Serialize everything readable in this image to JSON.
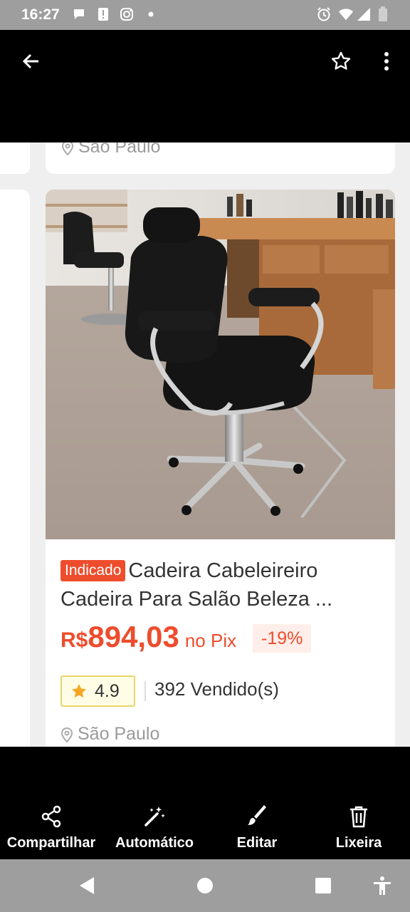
{
  "status_bar": {
    "time": "16:27",
    "icons": [
      "chat-bubble-icon",
      "alert-icon",
      "instagram-icon",
      "dot-icon",
      "alarm-icon",
      "wifi-icon",
      "signal-icon",
      "battery-icon"
    ]
  },
  "app_bar": {
    "back_icon": "arrow-left-icon",
    "favorite_icon": "star-outline-icon",
    "menu_icon": "more-vert-icon"
  },
  "top_card": {
    "location": "São Paulo"
  },
  "product": {
    "badge": "Indicado",
    "title_line1": "Cadeira Cabeleireiro",
    "title_line2": "Cadeira Para Salão Beleza ...",
    "currency": "R$",
    "price": "894,03",
    "payment_method": "no Pix",
    "discount": "-19%",
    "rating": "4.9",
    "sold": "392 Vendido(s)",
    "location": "São Paulo",
    "image_alt": "black salon chair"
  },
  "actions": [
    {
      "label": "Compartilhar",
      "icon": "share-icon"
    },
    {
      "label": "Automático",
      "icon": "magic-wand-icon"
    },
    {
      "label": "Editar",
      "icon": "brush-icon"
    },
    {
      "label": "Lixeira",
      "icon": "trash-icon"
    }
  ],
  "nav_bar": {
    "icons": [
      "back-triangle-icon",
      "home-circle-icon",
      "recents-square-icon",
      "accessibility-icon"
    ]
  },
  "colors": {
    "accent": "#ee4d2d",
    "status_bar": "#9e9e9e",
    "rating_star": "#f5a623"
  }
}
